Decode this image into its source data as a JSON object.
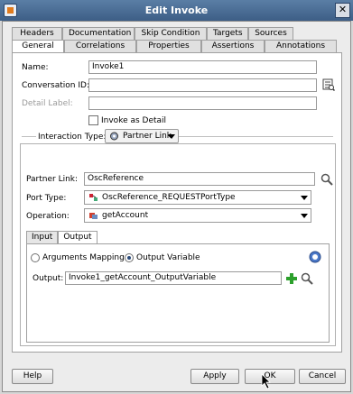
{
  "window": {
    "title": "Edit Invoke",
    "close_glyph": "✕"
  },
  "tabs_row1": [
    "Headers",
    "Documentation",
    "Skip Condition",
    "Targets",
    "Sources"
  ],
  "tabs_row2": [
    "General",
    "Correlations",
    "Properties",
    "Assertions",
    "Annotations"
  ],
  "active_tab": "General",
  "general": {
    "name_label": "Name:",
    "name_value": "Invoke1",
    "conversation_label": "Conversation ID:",
    "conversation_value": "",
    "detail_label": "Detail Label:",
    "detail_value": "",
    "invoke_as_detail_label": "Invoke as Detail",
    "invoke_as_detail_checked": false
  },
  "interaction": {
    "label": "Interaction Type:",
    "value": "Partner Link",
    "partner_link_label": "Partner Link:",
    "partner_link_value": "OscReference",
    "port_type_label": "Port Type:",
    "port_type_value": "OscReference_REQUESTPortType",
    "operation_label": "Operation:",
    "operation_value": "getAccount"
  },
  "io_tabs": [
    "Input",
    "Output"
  ],
  "active_io_tab": "Output",
  "output": {
    "arguments_mapping_label": "Arguments Mapping",
    "output_variable_label": "Output Variable",
    "selected": "Output Variable",
    "output_label": "Output:",
    "output_value": "Invoke1_getAccount_OutputVariable"
  },
  "buttons": {
    "help": "Help",
    "apply": "Apply",
    "ok": "OK",
    "cancel": "Cancel"
  },
  "icons": {
    "search": "search-icon",
    "add": "add-icon",
    "help": "help-icon",
    "browse": "browse-icon",
    "partner_link": "partner-link-icon",
    "port_type": "port-type-icon",
    "operation": "operation-icon"
  }
}
